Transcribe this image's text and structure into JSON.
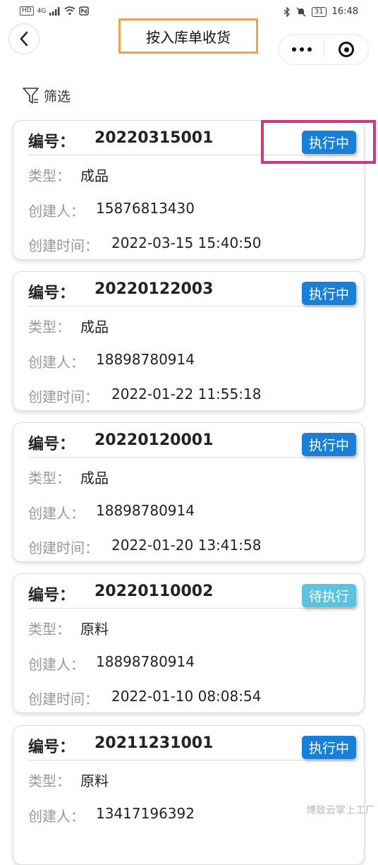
{
  "status_bar": {
    "left_badges": [
      "HD",
      "4G"
    ],
    "right_badge": "31",
    "time": "16:48",
    "icons": [
      "signal-icon",
      "wifi-icon",
      "nfc-icon",
      "bluetooth-icon",
      "mute-icon",
      "battery-icon"
    ]
  },
  "nav": {
    "title": "按入库单收货",
    "back_icon": "chevron-left-icon",
    "more_icon": "more-dots-icon",
    "close_icon": "target-close-icon"
  },
  "filter": {
    "label": "筛选",
    "icon": "funnel-icon"
  },
  "labels": {
    "code": "编号：",
    "type": "类型：",
    "creator": "创建人：",
    "created_at": "创建时间："
  },
  "orders": [
    {
      "code": "20220315001",
      "status": "执行中",
      "status_kind": "run",
      "type": "成品",
      "creator": "15876813430",
      "created_at": "2022-03-15 15:40:50"
    },
    {
      "code": "20220122003",
      "status": "执行中",
      "status_kind": "run",
      "type": "成品",
      "creator": "18898780914",
      "created_at": "2022-01-22 11:55:18"
    },
    {
      "code": "20220120001",
      "status": "执行中",
      "status_kind": "run",
      "type": "成品",
      "creator": "18898780914",
      "created_at": "2022-01-20 13:41:58"
    },
    {
      "code": "20220110002",
      "status": "待执行",
      "status_kind": "wait",
      "type": "原料",
      "creator": "18898780914",
      "created_at": "2022-01-10 08:08:54"
    },
    {
      "code": "20211231001",
      "status": "执行中",
      "status_kind": "run",
      "type": "原料",
      "creator": "13417196392",
      "created_at": ""
    }
  ],
  "watermark": "博致云掌上工厂",
  "colors": {
    "running": "#1a7fd6",
    "waiting": "#5cc3df",
    "title_outline": "#f0a055",
    "highlight_outline": "#d6357a"
  }
}
